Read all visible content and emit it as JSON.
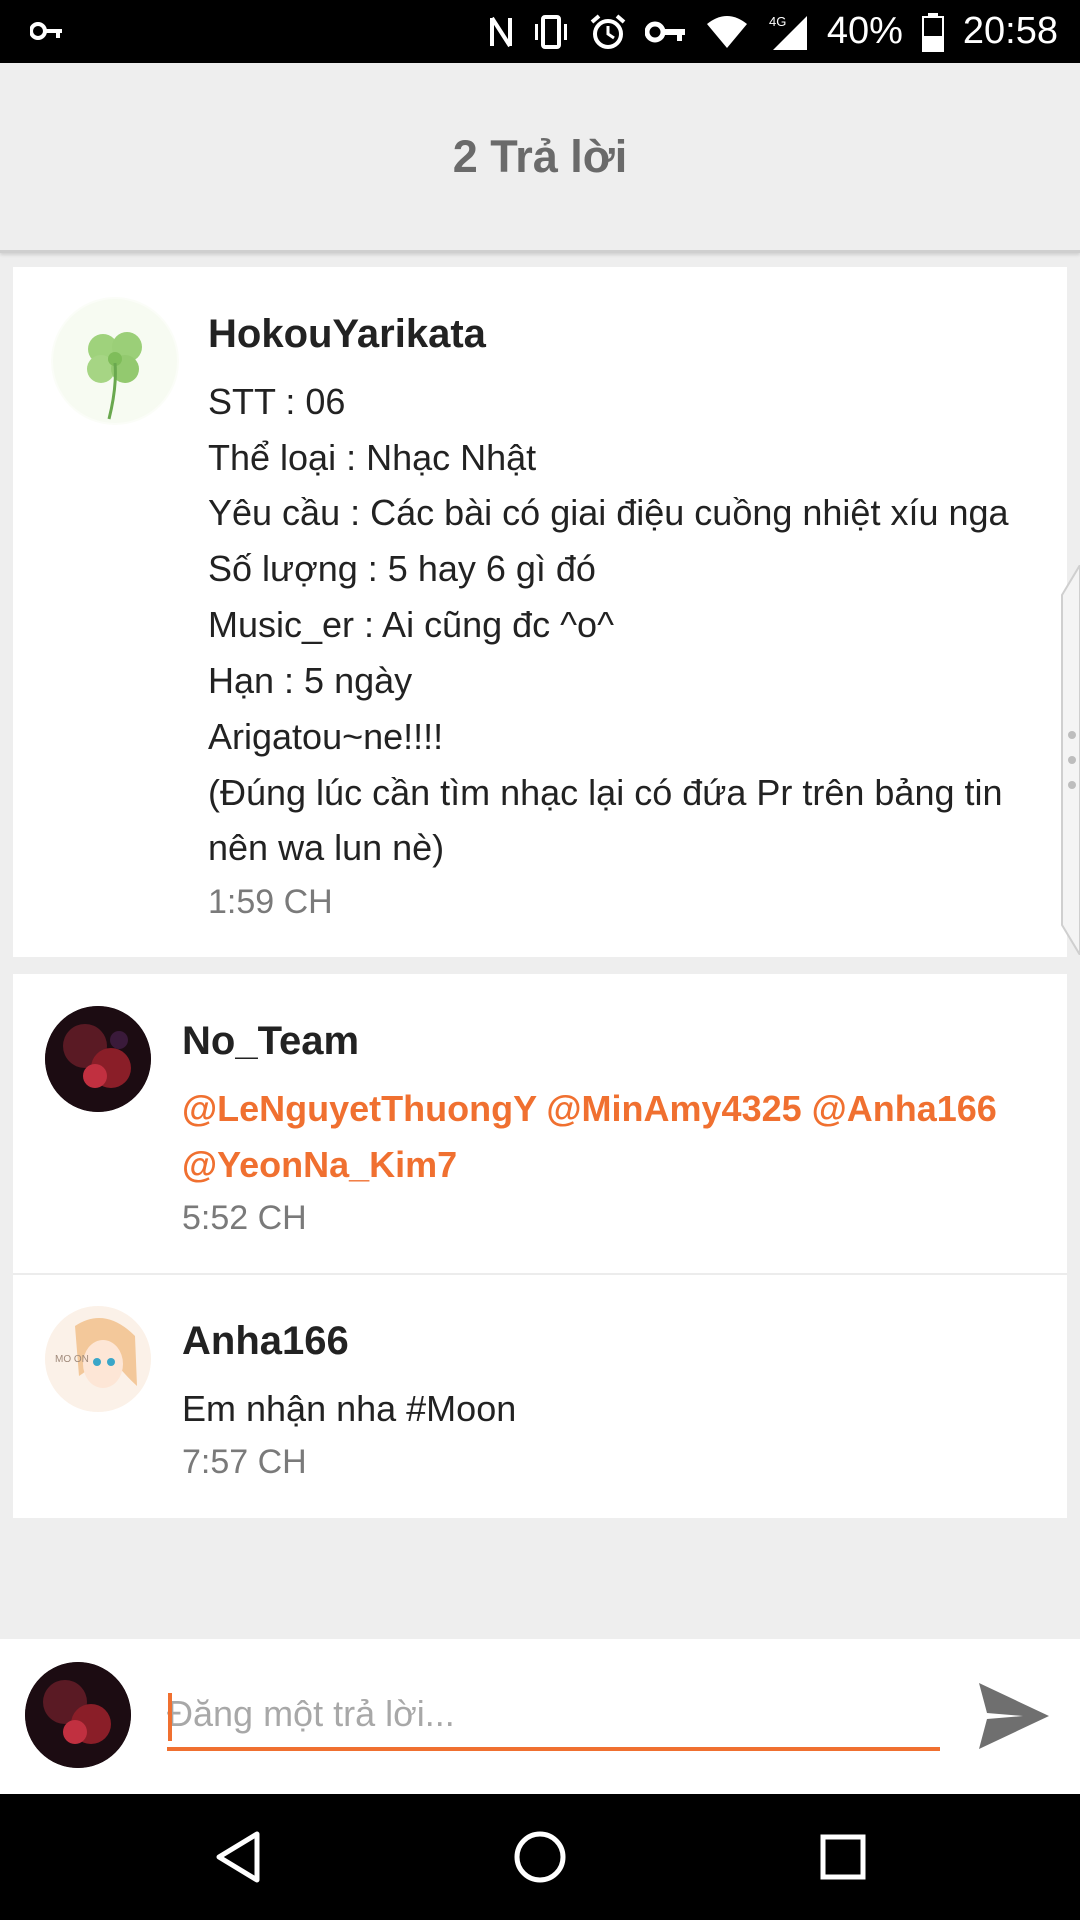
{
  "status_bar": {
    "battery": "40%",
    "time": "20:58",
    "network": "4G",
    "icons": [
      "key-icon",
      "nfc-icon",
      "vibrate-icon",
      "alarm-icon",
      "key-icon",
      "wifi-icon",
      "signal-icon",
      "battery-icon"
    ]
  },
  "header": {
    "title": "2 Trả lời"
  },
  "post": {
    "username": "HokouYarikata",
    "lines": [
      "STT : 06",
      "Thể loại : Nhạc Nhật",
      "Yêu cầu : Các bài có giai điệu cuồng nhiệt xíu nga",
      "Số lượng : 5 hay 6 gì đó",
      "Music_er : Ai cũng đc ^o^",
      "Hạn : 5 ngày",
      "Arigatou~ne!!!!",
      "(Đúng lúc cần tìm nhạc lại có đứa Pr trên bảng tin",
      "nên wa lun nè)"
    ],
    "time": "1:59 CH"
  },
  "replies": [
    {
      "username": "No_Team",
      "mention_lines": [
        "@LeNguyetThuongY @MinAmy4325 @Anha166",
        "@YeonNa_Kim7"
      ],
      "time": "5:52 CH"
    },
    {
      "username": "Anha166",
      "text": "Em nhận nha #Moon",
      "time": "7:57 CH",
      "avatar_text": "MO ON"
    }
  ],
  "composer": {
    "placeholder": "Đăng một trả lời..."
  },
  "colors": {
    "accent": "#f07030",
    "header_bg": "#eeeeee",
    "text": "#222222",
    "muted": "#7a7a7a"
  }
}
